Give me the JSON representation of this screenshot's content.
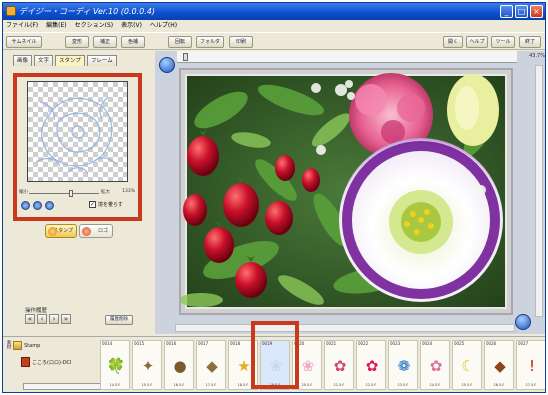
{
  "window": {
    "title": "デイジー・コーディ Ver.10 (0.0.0.4)",
    "controls": [
      "_",
      "□",
      "×"
    ]
  },
  "menu": [
    "ファイル(F)",
    "編集(E)",
    "セクション(S)",
    "表示(V)",
    "ヘルプ(H)"
  ],
  "toolbar": {
    "left_buttons": [
      "サムネイル",
      "変形",
      "補正",
      "色補",
      "回転",
      "フォルダ",
      "印刷"
    ],
    "right_buttons": [
      "開く",
      "ヘルプ",
      "ツール",
      "終了"
    ]
  },
  "left_panel": {
    "tabs": [
      "画像",
      "文字",
      "スタンプ",
      "フレーム"
    ],
    "active_tab": "スタンプ",
    "zoom_min": "縮小",
    "zoom_max": "拡大",
    "zoom_value": "133%",
    "zoom_level": 0.72,
    "blur_label": "境を暈らす",
    "blur_checked": true,
    "stamp_button": "スタンプ",
    "logo_button": "ロゴ",
    "history_label": "操作履歴",
    "history_button": "履歴削除"
  },
  "canvas": {
    "zoom_readout": "43.7%"
  },
  "bottom_strip": {
    "side_label": "素材",
    "folder_label": "Stamp",
    "subfolder_label": "こころ(ロロ)-DCI",
    "thumbnails": [
      {
        "num": "0014",
        "cap": "14.5.F",
        "glyph": "🍀",
        "color": "#3a9a2a",
        "selected": false
      },
      {
        "num": "0015",
        "cap": "15.5.F",
        "glyph": "✦",
        "color": "#8a6a3a",
        "selected": false
      },
      {
        "num": "0016",
        "cap": "16.5.F",
        "glyph": "●",
        "color": "#7a5a2a",
        "selected": false
      },
      {
        "num": "0017",
        "cap": "17.5.F",
        "glyph": "◆",
        "color": "#8a7040",
        "selected": false
      },
      {
        "num": "0018",
        "cap": "18.5.F",
        "glyph": "★",
        "color": "#e0b020",
        "selected": false
      },
      {
        "num": "0019",
        "cap": "19.5.F",
        "glyph": "❀",
        "color": "#c8d8f0",
        "selected": true
      },
      {
        "num": "0020",
        "cap": "20.5.F",
        "glyph": "❀",
        "color": "#f0a8c8",
        "selected": false
      },
      {
        "num": "0021",
        "cap": "21.5.F",
        "glyph": "✿",
        "color": "#d04870",
        "selected": false
      },
      {
        "num": "0022",
        "cap": "22.5.F",
        "glyph": "✿",
        "color": "#e01850",
        "selected": false
      },
      {
        "num": "0023",
        "cap": "23.5.F",
        "glyph": "❁",
        "color": "#2070c0",
        "selected": false
      },
      {
        "num": "0024",
        "cap": "24.5.F",
        "glyph": "✿",
        "color": "#e070a0",
        "selected": false
      },
      {
        "num": "0025",
        "cap": "25.5.F",
        "glyph": "☾",
        "color": "#e8c020",
        "selected": false
      },
      {
        "num": "0026",
        "cap": "26.5.F",
        "glyph": "◆",
        "color": "#8a4818",
        "selected": false
      },
      {
        "num": "0027",
        "cap": "27.5.F",
        "glyph": "!",
        "color": "#c02010",
        "selected": false
      }
    ]
  },
  "colors": {
    "highlight": "#c93a1c",
    "titlebar": "#0a4fd0",
    "panel": "#ece9d8"
  }
}
